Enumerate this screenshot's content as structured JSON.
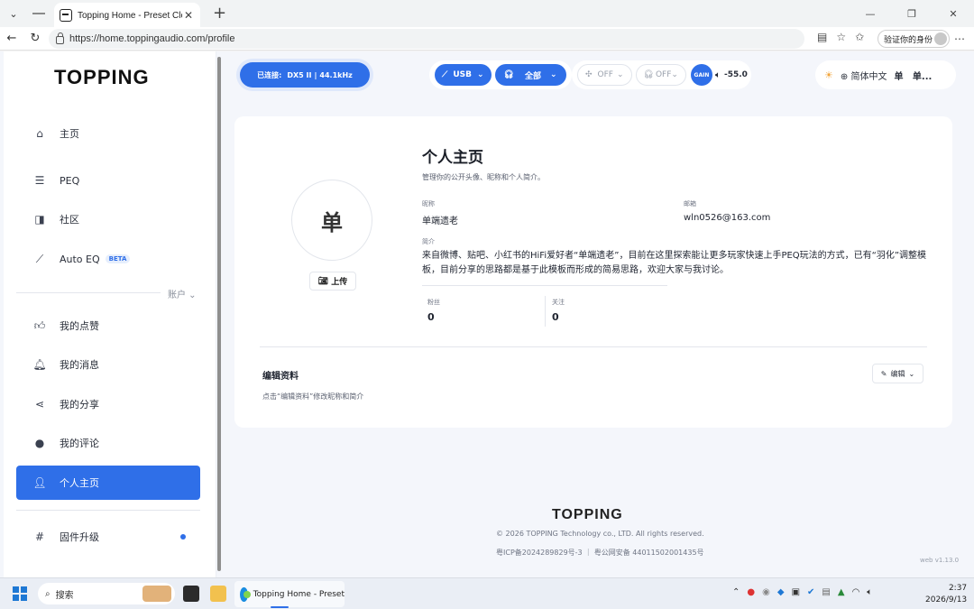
{
  "browser": {
    "tab_title": "Topping Home - Preset Cloud",
    "tab_close": "✕",
    "new_tab": "+",
    "url": "https://home.toppingaudio.com/profile",
    "profile_label": "验证你的身份",
    "win_min": "—",
    "win_max": "❐",
    "win_close": "✕"
  },
  "sidebar": {
    "logo": "TOPPING",
    "items": [
      {
        "label": "主页",
        "icon": "home-icon"
      },
      {
        "label": "PEQ",
        "icon": "sliders-icon"
      },
      {
        "label": "社区",
        "icon": "chat-icon"
      },
      {
        "label": "Auto EQ",
        "icon": "chart-line-icon",
        "badge": "BETA"
      }
    ],
    "account_label": "账户",
    "account_items": [
      {
        "label": "我的点赞",
        "icon": "thumbs-up-icon"
      },
      {
        "label": "我的消息",
        "icon": "bell-icon"
      },
      {
        "label": "我的分享",
        "icon": "share-icon"
      },
      {
        "label": "我的评论",
        "icon": "comment-icon"
      },
      {
        "label": "个人主页",
        "icon": "user-icon",
        "active": true
      }
    ],
    "firmware": {
      "label": "固件升级",
      "icon": "hash-icon"
    }
  },
  "topbar": {
    "connected_label": "已连接:",
    "device": "DX5 II",
    "sample_rate": "44.1kHz",
    "input": "USB",
    "output": "全部",
    "filter_state": "OFF",
    "headphone_state": "OFF",
    "gain_label": "GAIN",
    "volume": "-55.0",
    "language": "简体中文",
    "user_initial": "单",
    "user_short": "单..."
  },
  "profile": {
    "title": "个人主页",
    "subtitle": "管理你的公开头像、昵称和个人简介。",
    "avatar_char": "单",
    "upload_label": "上传",
    "nickname_label": "昵称",
    "nickname": "单端遗老",
    "email_label": "邮箱",
    "email": "wln0526@163.com",
    "bio_label": "简介",
    "bio": "来自微博、贴吧、小红书的HiFi爱好者“单端遗老”，目前在这里探索能让更多玩家快速上手PEQ玩法的方式，已有“羽化”调整模板，目前分享的思路都是基于此模板而形成的简易思路，欢迎大家与我讨论。",
    "followers_label": "粉丝",
    "followers": "0",
    "following_label": "关注",
    "following": "0",
    "edit_section_title": "编辑资料",
    "edit_hint": "点击“编辑资料”修改昵称和简介",
    "edit_button": "编辑"
  },
  "footer": {
    "logo": "TOPPING",
    "copyright": "© 2026 TOPPING Technology co., LTD. All rights reserved.",
    "icp": "粤ICP备2024289829号-3 ｜ 粤公网安备 44011502001435号",
    "version": "web v1.13.0"
  },
  "taskbar": {
    "search_label": "搜索",
    "app_label": "Topping Home - Preset",
    "time": "2:37",
    "date": "2026/9/13"
  },
  "colors": {
    "accent": "#2f6fe8",
    "page_bg": "#f4f6fb",
    "card_bg": "#ffffff"
  }
}
